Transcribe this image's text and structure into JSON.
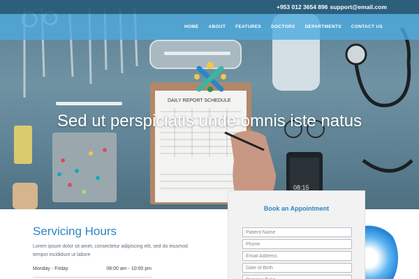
{
  "topbar": {
    "phone": "+953 012 3654 896",
    "email": "support@email.com"
  },
  "nav": [
    {
      "label": "HOME",
      "active": true
    },
    {
      "label": "ABOUT"
    },
    {
      "label": "FEATURES"
    },
    {
      "label": "DOCTORS"
    },
    {
      "label": "DEPARTMENTS"
    },
    {
      "label": "CONTACT US"
    }
  ],
  "hero": {
    "title": "Sed ut perspiciatis unde omnis iste natus"
  },
  "hero_image": {
    "clipboard_heading": "DAILY REPORT SCHEDULE",
    "phone_time": "08:15"
  },
  "service": {
    "title": "Servicing Hours",
    "text": "Lorem ipsum dolor sit amet, consectetur adipiscing elit, sed do eiusmod tempor incididunt ut labore",
    "rows": [
      {
        "day": "Monday - Friday",
        "time": "08:00 am - 10:00 pm"
      }
    ]
  },
  "appointment": {
    "title": "Book an Appointment",
    "fields": [
      {
        "placeholder": "Patient Name"
      },
      {
        "placeholder": "Phone"
      },
      {
        "placeholder": "Email Address"
      },
      {
        "placeholder": "Date of Birth"
      },
      {
        "placeholder": "Disease Type"
      }
    ]
  },
  "colors": {
    "accent": "#2a86c5",
    "nav_bg": "#4eaade",
    "topbar_bg": "#285c78"
  }
}
